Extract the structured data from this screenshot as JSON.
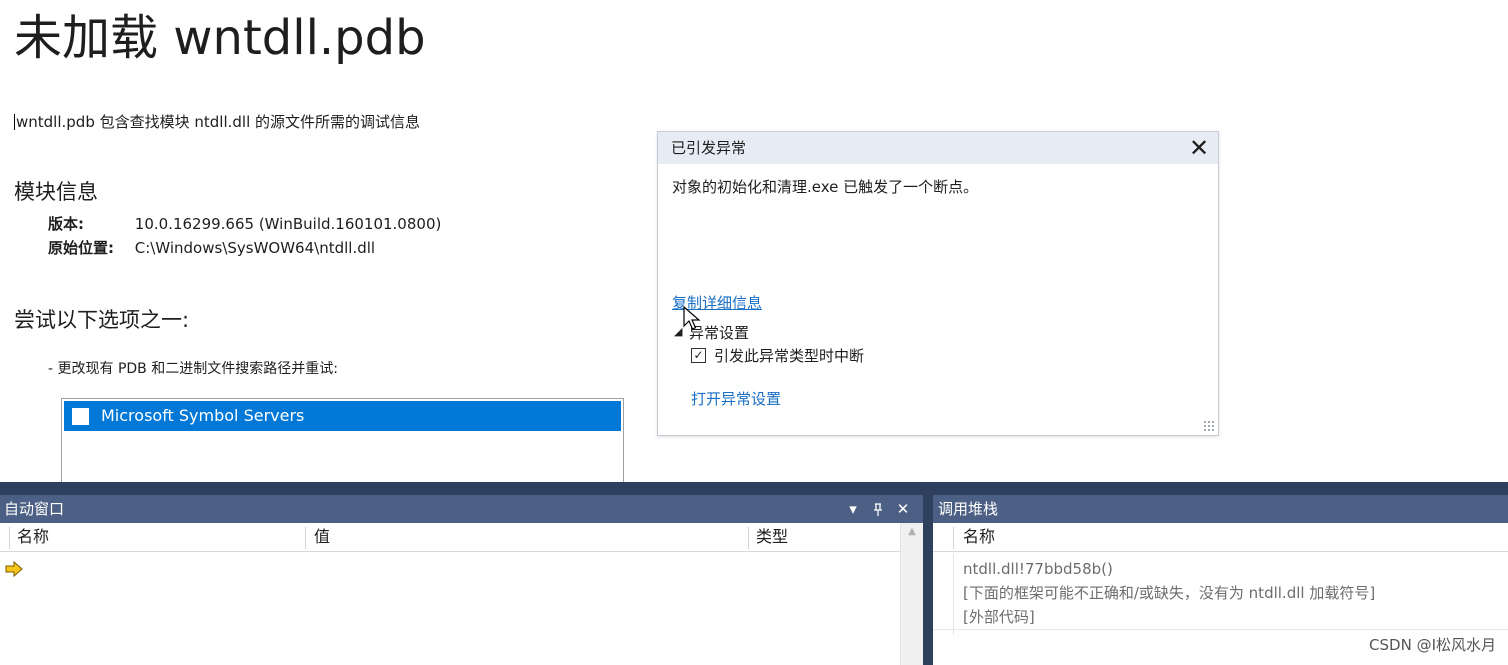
{
  "document": {
    "title": "未加载 wntdll.pdb",
    "description": "wntdll.pdb 包含查找模块 ntdll.dll 的源文件所需的调试信息",
    "module_info": {
      "heading": "模块信息",
      "version_label": "版本:",
      "version_value": "10.0.16299.665 (WinBuild.160101.0800)",
      "location_label": "原始位置:",
      "location_value": "C:\\Windows\\SysWOW64\\ntdll.dll"
    },
    "options": {
      "heading": "尝试以下选项之一:",
      "bullet": "-  更改现有 PDB 和二进制文件搜索路径并重试:",
      "symbol_servers": [
        {
          "label": "Microsoft Symbol Servers",
          "checked": false,
          "selected": true
        }
      ]
    }
  },
  "exception_popup": {
    "title": "已引发异常",
    "message": "对象的初始化和清理.exe 已触发了一个断点。",
    "copy_details_link": "复制详细信息",
    "settings_toggle_icon": "collapse-triangle-icon",
    "settings_heading": "异常设置",
    "break_checkbox": {
      "label": "引发此异常类型时中断",
      "checked": true
    },
    "open_settings_link": "打开异常设置"
  },
  "autos_window": {
    "title": "自动窗口",
    "buttons": [
      "dropdown-icon",
      "pin-icon",
      "close-icon"
    ],
    "columns": [
      "名称",
      "值",
      "类型"
    ]
  },
  "call_stack_window": {
    "title": "调用堆栈",
    "columns": [
      "名称"
    ],
    "rows": [
      {
        "text": "ntdll.dll!77bbd58b()",
        "current": true
      },
      {
        "text": "[下面的框架可能不正确和/或缺失，没有为 ntdll.dll 加载符号]",
        "current": false
      },
      {
        "text": "[外部代码]",
        "current": false
      }
    ]
  },
  "watermark": "CSDN @I松风水月",
  "colors": {
    "selection": "#0078d7",
    "link": "#1a6fc4",
    "tool_header": "#4c5f84",
    "dock_background": "#2f3f5e",
    "popup_header": "#e7ebf3",
    "current_frame_arrow": "#f5c518"
  }
}
